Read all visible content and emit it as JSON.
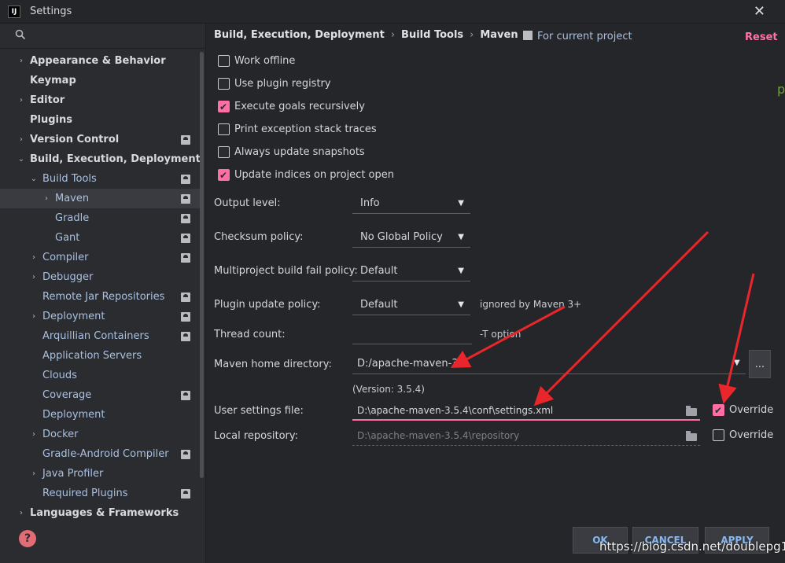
{
  "window": {
    "title": "Settings",
    "app_icon_text": "IJ",
    "close_label": "✕"
  },
  "sidebar": {
    "search_placeholder": "",
    "items": [
      {
        "label": "Appearance & Behavior",
        "arrow": "›",
        "bold": true
      },
      {
        "label": "Keymap",
        "arrow": "",
        "bold": true
      },
      {
        "label": "Editor",
        "arrow": "›",
        "bold": true
      },
      {
        "label": "Plugins",
        "arrow": "",
        "bold": true
      },
      {
        "label": "Version Control",
        "arrow": "›",
        "bold": true
      },
      {
        "label": "Build, Execution, Deployment",
        "arrow": "⌄",
        "bold": true
      },
      {
        "label": "Build Tools",
        "arrow": "⌄"
      },
      {
        "label": "Maven",
        "arrow": "›"
      },
      {
        "label": "Gradle",
        "arrow": ""
      },
      {
        "label": "Gant",
        "arrow": ""
      },
      {
        "label": "Compiler",
        "arrow": "›"
      },
      {
        "label": "Debugger",
        "arrow": "›"
      },
      {
        "label": "Remote Jar Repositories",
        "arrow": ""
      },
      {
        "label": "Deployment",
        "arrow": "›"
      },
      {
        "label": "Arquillian Containers",
        "arrow": ""
      },
      {
        "label": "Application Servers",
        "arrow": ""
      },
      {
        "label": "Clouds",
        "arrow": ""
      },
      {
        "label": "Coverage",
        "arrow": ""
      },
      {
        "label": "Deployment",
        "arrow": ""
      },
      {
        "label": "Docker",
        "arrow": "›"
      },
      {
        "label": "Gradle-Android Compiler",
        "arrow": ""
      },
      {
        "label": "Java Profiler",
        "arrow": "›"
      },
      {
        "label": "Required Plugins",
        "arrow": ""
      },
      {
        "label": "Languages & Frameworks",
        "arrow": "›",
        "bold": true
      }
    ],
    "help_label": "?"
  },
  "breadcrumb": {
    "part1": "Build, Execution, Deployment",
    "part2": "Build Tools",
    "part3": "Maven",
    "sep": "›"
  },
  "for_project": "For current project",
  "reset_label": "Reset",
  "checkboxes": [
    {
      "label": "Work offline",
      "checked": false
    },
    {
      "label": "Use plugin registry",
      "checked": false
    },
    {
      "label": "Execute goals recursively",
      "checked": true
    },
    {
      "label": "Print exception stack traces",
      "checked": false
    },
    {
      "label": "Always update snapshots",
      "checked": false
    },
    {
      "label": "Update indices on project open",
      "checked": true
    }
  ],
  "fields": {
    "output_level": {
      "label": "Output level:",
      "value": "Info"
    },
    "checksum_policy": {
      "label": "Checksum policy:",
      "value": "No Global Policy"
    },
    "fail_policy": {
      "label": "Multiproject build fail policy:",
      "value": "Default"
    },
    "plugin_update": {
      "label": "Plugin update policy:",
      "value": "Default",
      "hint": "ignored by Maven 3+"
    },
    "thread_count": {
      "label": "Thread count:",
      "value": "",
      "hint": "-T option"
    },
    "maven_home": {
      "label": "Maven home directory:",
      "value": "D:/apache-maven-3.5",
      "browse": "...",
      "version": "(Version: 3.5.4)"
    },
    "user_settings": {
      "label": "User settings file:",
      "value": "D:\\apache-maven-3.5.4\\conf\\settings.xml",
      "override_label": "Override",
      "override_checked": true
    },
    "local_repo": {
      "label": "Local repository:",
      "value": "D:\\apache-maven-3.5.4\\repository",
      "override_label": "Override",
      "override_checked": false
    }
  },
  "buttons": {
    "ok": "OK",
    "cancel": "CANCEL",
    "apply": "APPLY"
  },
  "watermark": "https://blog.csdn.net/doublepg13",
  "edge_glyph": "p",
  "colors": {
    "accent": "#ff6fa6",
    "annotation_arrow": "#e8262b"
  }
}
